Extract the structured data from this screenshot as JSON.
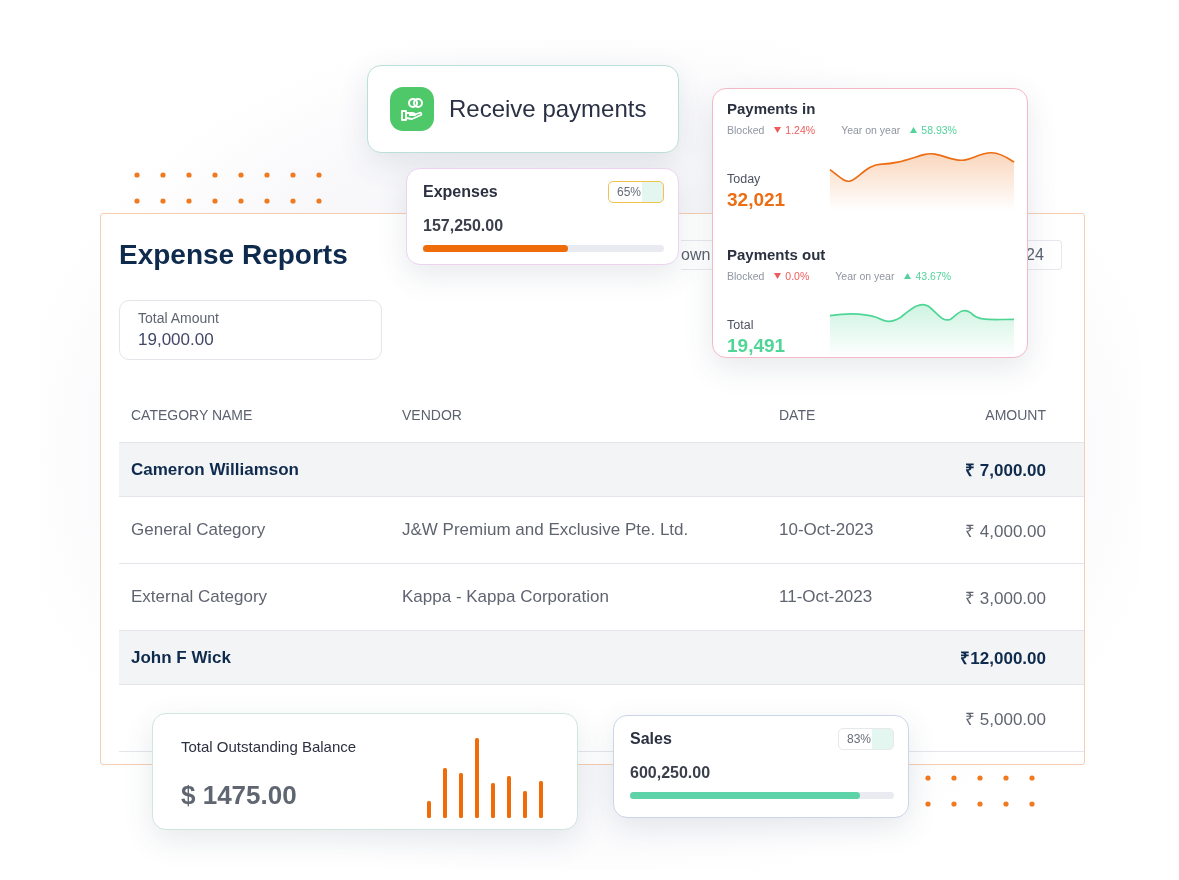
{
  "receive_card": {
    "label": "Receive payments"
  },
  "report": {
    "title": "Expense Reports",
    "filters": [
      {
        "label": "own"
      },
      {
        "label": "24"
      }
    ],
    "total": {
      "label": "Total Amount",
      "value": "19,000.00"
    },
    "table": {
      "columns": [
        "CATEGORY NAME",
        "VENDOR",
        "DATE",
        "AMOUNT"
      ],
      "rows": [
        {
          "kind": "group",
          "category": "Cameron Williamson",
          "amount": "₹ 7,000.00"
        },
        {
          "kind": "item",
          "category": "General Category",
          "vendor": "J&W Premium and Exclusive Pte. Ltd.",
          "date": "10-Oct-2023",
          "amount": "₹ 4,000.00"
        },
        {
          "kind": "item",
          "category": "External Category",
          "vendor": "Kappa - Kappa Corporation",
          "date": "11-Oct-2023",
          "amount": "₹ 3,000.00"
        },
        {
          "kind": "group",
          "category": "John F Wick",
          "amount": "₹12,000.00"
        },
        {
          "kind": "item",
          "amount": "₹ 5,000.00"
        }
      ]
    }
  },
  "stat_cards": [
    {
      "title": "Expenses",
      "value": "157,250.00",
      "badge": "65%",
      "level": 0.6,
      "color": "#ef6c0a"
    },
    {
      "title": "Sales",
      "value": "600,250.00",
      "badge": "83%",
      "level": 0.87,
      "color": "#5fd3a8"
    }
  ],
  "payments": [
    {
      "title": "Payments in",
      "blocked_label": "Blocked",
      "blocked_rising": false,
      "blocked_value": "1.24%",
      "yoy_label": "Year on year",
      "yoy_rising": true,
      "yoy_value": "58.93%",
      "metric_label": "Today",
      "metric_value": "32,021",
      "color": "#ec6d12"
    },
    {
      "title": "Payments out",
      "blocked_label": "Blocked",
      "blocked_rising": false,
      "blocked_value": "0.0%",
      "yoy_label": "Year on year",
      "yoy_rising": true,
      "yoy_value": "43.67%",
      "metric_label": "Total",
      "metric_value": "19,491",
      "color": "#4fd696"
    }
  ],
  "balance_card": {
    "title": "Total Outstanding Balance",
    "value": "$ 1475.00"
  }
}
